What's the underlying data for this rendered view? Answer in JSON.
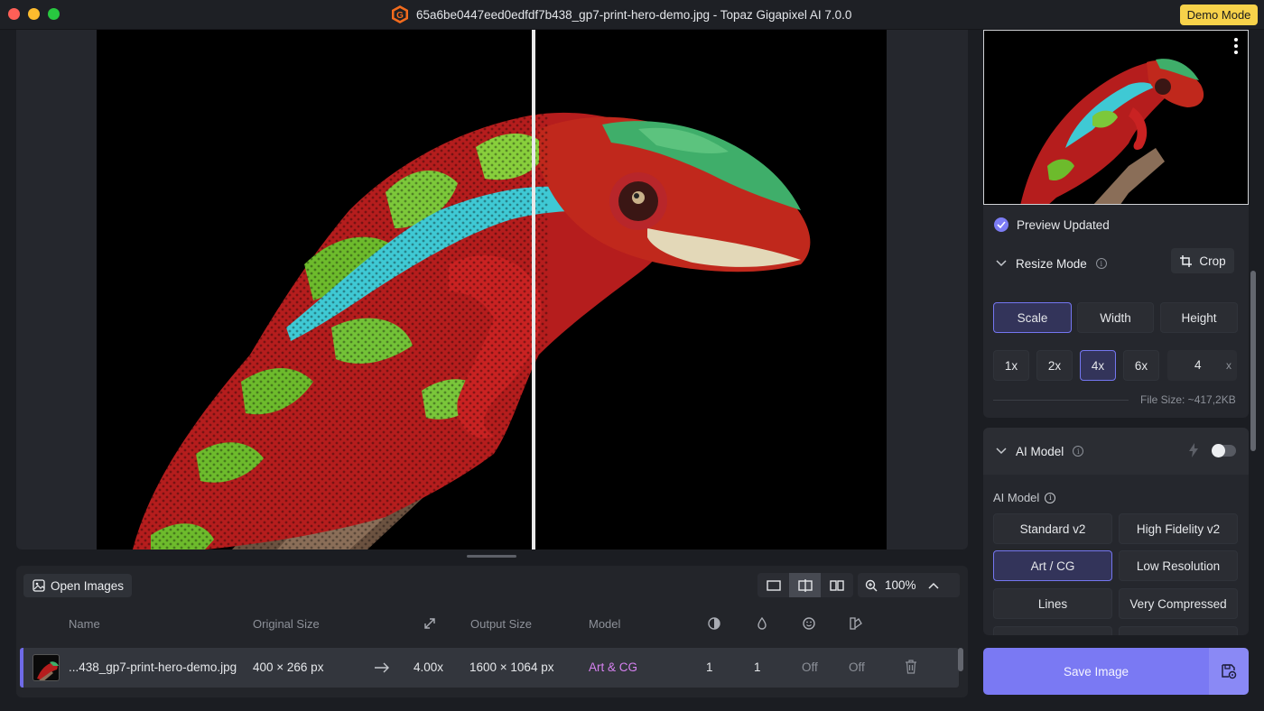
{
  "window": {
    "title": "65a6be0447eed0edfdf7b438_gp7-print-hero-demo.jpg - Topaz Gigapixel AI 7.0.0",
    "demo_badge": "Demo Mode"
  },
  "toolbar": {
    "open_images": "Open Images",
    "zoom": "100%"
  },
  "table": {
    "headers": {
      "name": "Name",
      "original_size": "Original Size",
      "output_size": "Output Size",
      "model": "Model"
    },
    "row": {
      "name": "...438_gp7-print-hero-demo.jpg",
      "original_size": "400 × 266 px",
      "scale": "4.00x",
      "output_size": "1600 × 1064 px",
      "model": "Art & CG",
      "val1": "1",
      "val2": "1",
      "val3": "Off",
      "val4": "Off"
    }
  },
  "right_panel": {
    "preview_status": "Preview Updated",
    "resize": {
      "title": "Resize Mode",
      "crop": "Crop",
      "modes": [
        "Scale",
        "Width",
        "Height"
      ],
      "active_mode": "Scale",
      "scales": [
        "1x",
        "2x",
        "4x",
        "6x"
      ],
      "active_scale": "4x",
      "custom_value": "4",
      "custom_unit": "x",
      "file_size": "File Size: ~417,2KB"
    },
    "ai_model": {
      "title": "AI Model",
      "label": "AI Model",
      "models": [
        "Standard v2",
        "High Fidelity v2",
        "Art / CG",
        "Low Resolution",
        "Lines",
        "Very Compressed"
      ],
      "active_model": "Art / CG"
    },
    "save": "Save Image"
  },
  "colors": {
    "accent": "#7a79f3",
    "model_text": "#d681f0",
    "demo_badge": "#f7d24a"
  }
}
